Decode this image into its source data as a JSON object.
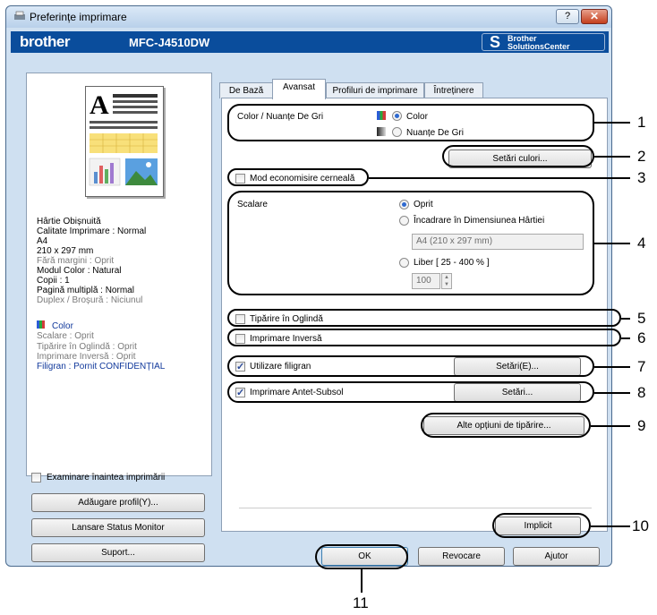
{
  "window": {
    "title": "Preferințe imprimare",
    "help": "?",
    "close": "✕"
  },
  "brand": {
    "logo": "brother",
    "model": "MFC-J4510DW",
    "solutions_line1": "Brother",
    "solutions_line2": "SolutionsCenter"
  },
  "tabs": [
    {
      "label": "De Bază"
    },
    {
      "label": "Avansat",
      "active": true
    },
    {
      "label": "Profiluri de imprimare"
    },
    {
      "label": "Întreținere"
    }
  ],
  "summary": {
    "paper": "Hârtie Obișnuită",
    "quality": "Calitate Imprimare : Normal",
    "size": "A4",
    "dims": "210 x 297 mm",
    "borderless": "Fără margini : Oprit",
    "color_mode": "Modul Color : Natural",
    "copies": "Copii : 1",
    "multipage": "Pagină multiplă : Normal",
    "duplex": "Duplex / Broșură : Niciunul",
    "color": "Color",
    "scaling": "Scalare : Oprit",
    "mirror": "Tipărire în Oglindă : Oprit",
    "reverse": "Imprimare Inversă : Oprit",
    "watermark": "Filigran : Pornit  CONFIDENȚIAL"
  },
  "left_controls": {
    "preview_check": "Examinare înaintea imprimării",
    "add_profile": "Adăugare profil(Y)...",
    "status_monitor": "Lansare Status Monitor",
    "support": "Suport..."
  },
  "advanced": {
    "color_label": "Color / Nuanțe De Gri",
    "color_opt": "Color",
    "gray_opt": "Nuanțe De Gri",
    "color_settings": "Setări culori...",
    "ink_save": "Mod economisire cerneală",
    "scaling_label": "Scalare",
    "scale_off": "Oprit",
    "scale_fit": "Încadrare în Dimensiunea Hârtiei",
    "paper_field": "A4 (210 x 297 mm)",
    "scale_free": "Liber [ 25 - 400 % ]",
    "percent": "100",
    "mirror": "Tipărire în Oglindă",
    "reverse": "Imprimare Inversă",
    "watermark": "Utilizare filigran",
    "watermark_settings": "Setări(E)...",
    "header_footer": "Imprimare Antet-Subsol",
    "header_settings": "Setări...",
    "other_options": "Alte opțiuni de tipărire...",
    "default": "Implicit"
  },
  "footer": {
    "ok": "OK",
    "cancel": "Revocare",
    "help": "Ajutor"
  },
  "callouts": [
    "1",
    "2",
    "3",
    "4",
    "5",
    "6",
    "7",
    "8",
    "9",
    "10",
    "11"
  ],
  "colors": {
    "brand_blue": "#0a4d9c",
    "window_bg": "#cfe0f1",
    "summary_blue": "#10389b"
  }
}
